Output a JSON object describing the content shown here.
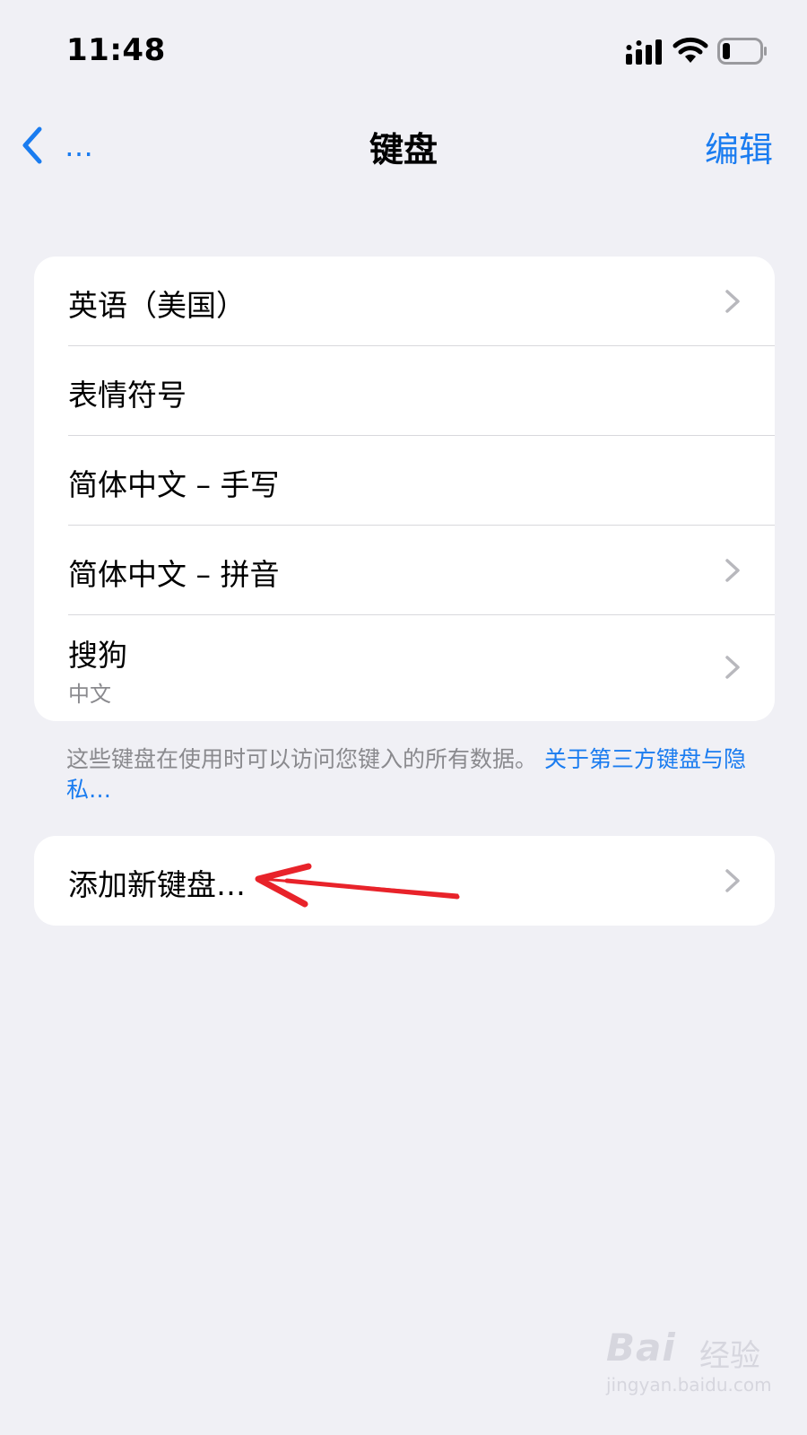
{
  "status_bar": {
    "time": "11:48"
  },
  "nav": {
    "back_label": "…",
    "title": "键盘",
    "edit_label": "编辑"
  },
  "keyboards": [
    {
      "label": "英语（美国）",
      "has_chevron": true
    },
    {
      "label": "表情符号",
      "has_chevron": false
    },
    {
      "label": "简体中文 – 手写",
      "has_chevron": false
    },
    {
      "label": "简体中文 – 拼音",
      "has_chevron": true
    },
    {
      "label": "搜狗",
      "sublabel": "中文",
      "has_chevron": true
    }
  ],
  "footer": {
    "text": "这些键盘在使用时可以访问您键入的所有数据。",
    "link": "关于第三方键盘与隐私…"
  },
  "add_keyboard": {
    "label": "添加新键盘…"
  },
  "watermark": {
    "brand": "Bai",
    "cn": "经验",
    "url": "jingyan.baidu.com"
  },
  "colors": {
    "accent": "#1a7cf0",
    "background": "#f0f0f5",
    "annotation": "#e8232a"
  }
}
